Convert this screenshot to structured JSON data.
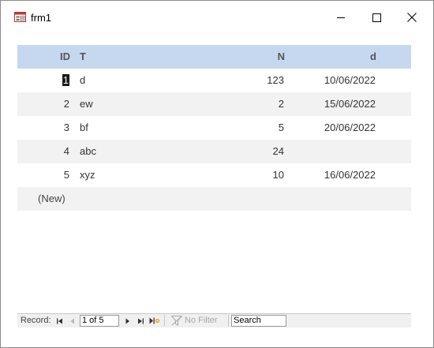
{
  "window": {
    "title": "frm1",
    "icons": {
      "app": "form-icon",
      "minimize": "minimize-icon",
      "maximize": "maximize-icon",
      "close": "close-icon"
    }
  },
  "table": {
    "columns": [
      "ID",
      "T",
      "N",
      "d"
    ],
    "rows": [
      {
        "id": "1",
        "t": "d",
        "n": "123",
        "d": "10/06/2022"
      },
      {
        "id": "2",
        "t": "ew",
        "n": "2",
        "d": "15/06/2022"
      },
      {
        "id": "3",
        "t": "bf",
        "n": "5",
        "d": "20/06/2022"
      },
      {
        "id": "4",
        "t": "abc",
        "n": "24",
        "d": ""
      },
      {
        "id": "5",
        "t": "xyz",
        "n": "10",
        "d": "16/06/2022"
      }
    ],
    "new_row_label": "(New)",
    "header_color": "#c5d8ef",
    "alt_row_color": "#f2f2f2"
  },
  "navigation": {
    "record_label": "Record:",
    "record_value": "1 of 5",
    "filter_label": "No Filter",
    "search_value": "Search",
    "icons": {
      "first": "first-record-icon",
      "prev": "previous-record-icon",
      "next": "next-record-icon",
      "last": "last-record-icon",
      "new": "new-record-icon",
      "filter": "filter-icon"
    }
  }
}
